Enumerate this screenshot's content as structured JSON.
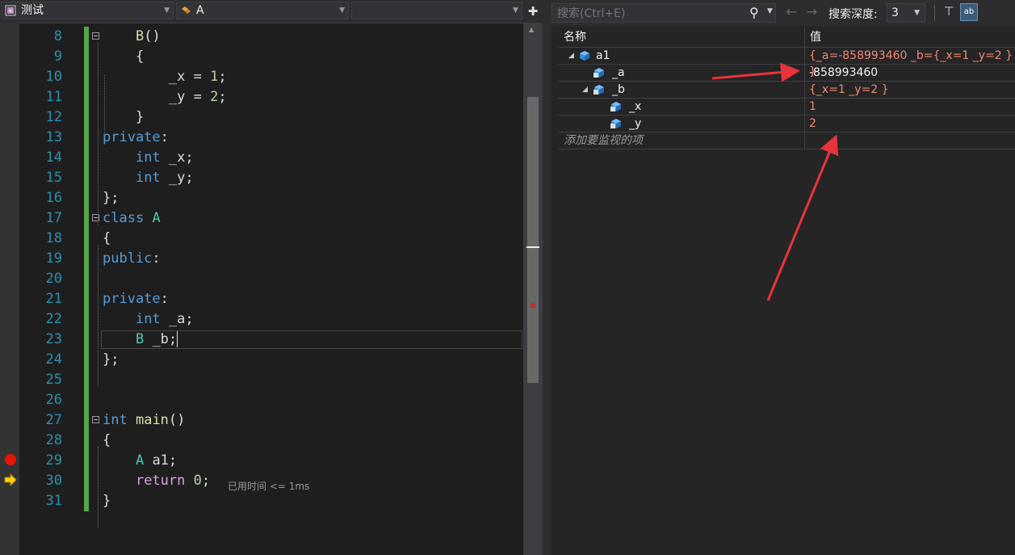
{
  "editor": {
    "scope_dropdown": "测试",
    "type_dropdown": "A",
    "member_dropdown": "",
    "elapsed_hint": "已用时间 <= 1ms",
    "lines": [
      {
        "n": "8",
        "tokens": [
          [
            "pl",
            "    "
          ],
          [
            "fn",
            "B"
          ],
          [
            "pl",
            "()"
          ]
        ]
      },
      {
        "n": "9",
        "tokens": [
          [
            "pl",
            "    {"
          ]
        ]
      },
      {
        "n": "10",
        "tokens": [
          [
            "pl",
            "        _x = "
          ],
          [
            "nm",
            "1"
          ],
          [
            "pl",
            ";"
          ]
        ]
      },
      {
        "n": "11",
        "tokens": [
          [
            "pl",
            "        _y = "
          ],
          [
            "nm",
            "2"
          ],
          [
            "pl",
            ";"
          ]
        ]
      },
      {
        "n": "12",
        "tokens": [
          [
            "pl",
            "    }"
          ]
        ]
      },
      {
        "n": "13",
        "tokens": [
          [
            "kw",
            "private"
          ],
          [
            "pl",
            ":"
          ]
        ]
      },
      {
        "n": "14",
        "tokens": [
          [
            "pl",
            "    "
          ],
          [
            "kw",
            "int"
          ],
          [
            "pl",
            " _x;"
          ]
        ]
      },
      {
        "n": "15",
        "tokens": [
          [
            "pl",
            "    "
          ],
          [
            "kw",
            "int"
          ],
          [
            "pl",
            " _y;"
          ]
        ]
      },
      {
        "n": "16",
        "tokens": [
          [
            "pl",
            "};"
          ]
        ]
      },
      {
        "n": "17",
        "tokens": [
          [
            "kw",
            "class"
          ],
          [
            "pl",
            " "
          ],
          [
            "ty",
            "A"
          ]
        ]
      },
      {
        "n": "18",
        "tokens": [
          [
            "pl",
            "{"
          ]
        ]
      },
      {
        "n": "19",
        "tokens": [
          [
            "kw",
            "public"
          ],
          [
            "pl",
            ":"
          ]
        ]
      },
      {
        "n": "20",
        "tokens": []
      },
      {
        "n": "21",
        "tokens": [
          [
            "kw",
            "private"
          ],
          [
            "pl",
            ":"
          ]
        ]
      },
      {
        "n": "22",
        "tokens": [
          [
            "pl",
            "    "
          ],
          [
            "kw",
            "int"
          ],
          [
            "pl",
            " _a;"
          ]
        ]
      },
      {
        "n": "23",
        "tokens": [
          [
            "pl",
            "    "
          ],
          [
            "ty",
            "B"
          ],
          [
            "pl",
            " _b;"
          ]
        ]
      },
      {
        "n": "24",
        "tokens": [
          [
            "pl",
            "};"
          ]
        ]
      },
      {
        "n": "25",
        "tokens": []
      },
      {
        "n": "26",
        "tokens": []
      },
      {
        "n": "27",
        "tokens": [
          [
            "kw",
            "int"
          ],
          [
            "pl",
            " "
          ],
          [
            "fn",
            "main"
          ],
          [
            "pl",
            "()"
          ]
        ]
      },
      {
        "n": "28",
        "tokens": [
          [
            "pl",
            "{"
          ]
        ]
      },
      {
        "n": "29",
        "tokens": [
          [
            "pl",
            "    "
          ],
          [
            "ty",
            "A"
          ],
          [
            "pl",
            " a1;"
          ]
        ]
      },
      {
        "n": "30",
        "tokens": [
          [
            "pl",
            "    "
          ],
          [
            "ctl",
            "return"
          ],
          [
            "pl",
            " "
          ],
          [
            "nm",
            "0"
          ],
          [
            "pl",
            ";"
          ]
        ]
      },
      {
        "n": "31",
        "tokens": [
          [
            "pl",
            "}"
          ]
        ]
      }
    ]
  },
  "watch": {
    "search_placeholder": "搜索(Ctrl+E)",
    "depth_label": "搜索深度:",
    "depth_value": "3",
    "col_name": "名称",
    "col_value": "值",
    "rows": [
      {
        "name": "a1",
        "value": "{_a=-858993460 _b={_x=1 _y=2 } }"
      },
      {
        "name": "_a",
        "value": "-858993460"
      },
      {
        "name": "_b",
        "value": "{_x=1 _y=2 }"
      },
      {
        "name": "_x",
        "value": "1"
      },
      {
        "name": "_y",
        "value": "2"
      }
    ],
    "add_item": "添加要监视的项"
  },
  "colors": {
    "keyword": "#569cd6",
    "type": "#4ec9b0",
    "changed_value": "#f48771",
    "annotation_arrow": "#e8333a"
  }
}
